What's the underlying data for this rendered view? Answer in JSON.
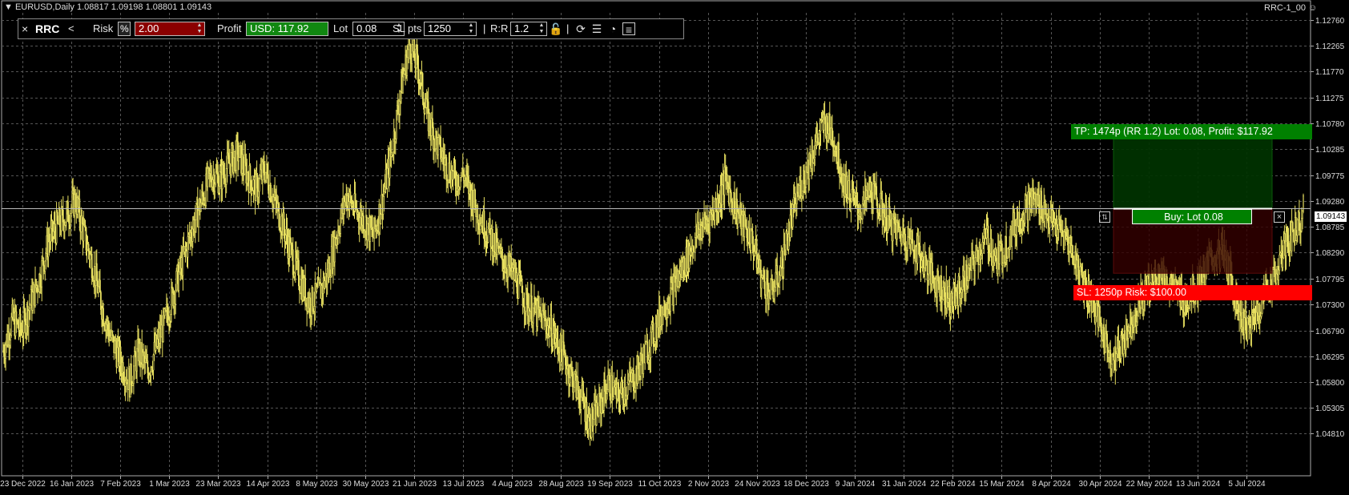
{
  "header": {
    "symbol_info": "▼ EURUSD,Daily  1.08817 1.09198 1.08801 1.09143",
    "ea_name": "RRC-1_00"
  },
  "panel": {
    "close_glyph": "×",
    "title": "RRC",
    "collapse_glyph": "<",
    "risk_label": "Risk",
    "risk_mode": "%",
    "risk_value": "2.00",
    "profit_label": "Profit",
    "profit_value": "USD: 117.92",
    "lot_label": "Lot",
    "lot_value": "0.08",
    "sl_label": "SL pts",
    "sl_value": "1250",
    "rr_label": "R:R",
    "rr_value": "1.2",
    "icons": [
      "lock-icon",
      "refresh-icon",
      "list-icon",
      "pie-chart-icon",
      "menu-icon"
    ]
  },
  "trade": {
    "tp_label": "TP: 1474p (RR 1.2) Lot: 0.08, Profit: $117.92",
    "sl_label": "SL: 1250p Risk: $100.00",
    "entry_label": "Buy: Lot 0.08",
    "entry_price": 1.09143,
    "tp_price": 1.10617,
    "sl_price": 1.07893,
    "current_price_label": "1.09143",
    "colors": {
      "tp": "#008000",
      "sl": "#ff0000",
      "tp_zone": "#003300",
      "sl_zone": "#330000"
    }
  },
  "chart_data": {
    "type": "candlestick",
    "symbol": "EURUSD",
    "timeframe": "Daily",
    "ylim": [
      1.04,
      1.129
    ],
    "y_ticks": [
      "1.12760",
      "1.12265",
      "1.11770",
      "1.11275",
      "1.10780",
      "1.10285",
      "1.09775",
      "1.09280",
      "1.08785",
      "1.08290",
      "1.07795",
      "1.07300",
      "1.06790",
      "1.06295",
      "1.05800",
      "1.05305",
      "1.04810"
    ],
    "x_ticks": [
      "23 Dec 2022",
      "16 Jan 2023",
      "7 Feb 2023",
      "1 Mar 2023",
      "23 Mar 2023",
      "14 Apr 2023",
      "8 May 2023",
      "30 May 2023",
      "21 Jun 2023",
      "13 Jul 2023",
      "4 Aug 2023",
      "28 Aug 2023",
      "19 Sep 2023",
      "11 Oct 2023",
      "2 Nov 2023",
      "24 Nov 2023",
      "18 Dec 2023",
      "9 Jan 2024",
      "31 Jan 2024",
      "22 Feb 2024",
      "15 Mar 2024",
      "8 Apr 2024",
      "30 Apr 2024",
      "22 May 2024",
      "13 Jun 2024",
      "5 Jul 2024"
    ],
    "closes": [
      1.064,
      1.07,
      1.068,
      1.073,
      1.078,
      1.085,
      1.088,
      1.09,
      1.093,
      1.086,
      1.08,
      1.072,
      1.066,
      1.062,
      1.058,
      1.064,
      1.06,
      1.065,
      1.07,
      1.076,
      1.082,
      1.088,
      1.093,
      1.098,
      1.097,
      1.1,
      1.102,
      1.098,
      1.095,
      1.099,
      1.093,
      1.088,
      1.082,
      1.077,
      1.073,
      1.075,
      1.079,
      1.087,
      1.094,
      1.091,
      1.089,
      1.086,
      1.093,
      1.102,
      1.114,
      1.123,
      1.118,
      1.109,
      1.104,
      1.1,
      1.097,
      1.098,
      1.093,
      1.089,
      1.086,
      1.082,
      1.08,
      1.077,
      1.073,
      1.071,
      1.07,
      1.067,
      1.063,
      1.059,
      1.055,
      1.05,
      1.053,
      1.058,
      1.055,
      1.057,
      1.059,
      1.063,
      1.067,
      1.072,
      1.075,
      1.079,
      1.083,
      1.087,
      1.089,
      1.092,
      1.097,
      1.092,
      1.088,
      1.085,
      1.078,
      1.075,
      1.079,
      1.087,
      1.094,
      1.099,
      1.104,
      1.108,
      1.105,
      1.097,
      1.093,
      1.091,
      1.095,
      1.092,
      1.089,
      1.087,
      1.086,
      1.084,
      1.081,
      1.078,
      1.076,
      1.073,
      1.076,
      1.079,
      1.083,
      1.086,
      1.081,
      1.084,
      1.088,
      1.091,
      1.093,
      1.092,
      1.089,
      1.087,
      1.085,
      1.08,
      1.076,
      1.072,
      1.066,
      1.062,
      1.066,
      1.07,
      1.074,
      1.077,
      1.079,
      1.077,
      1.075,
      1.074,
      1.076,
      1.079,
      1.082,
      1.083,
      1.078,
      1.071,
      1.068,
      1.072,
      1.076,
      1.079,
      1.084,
      1.087,
      1.091
    ]
  }
}
